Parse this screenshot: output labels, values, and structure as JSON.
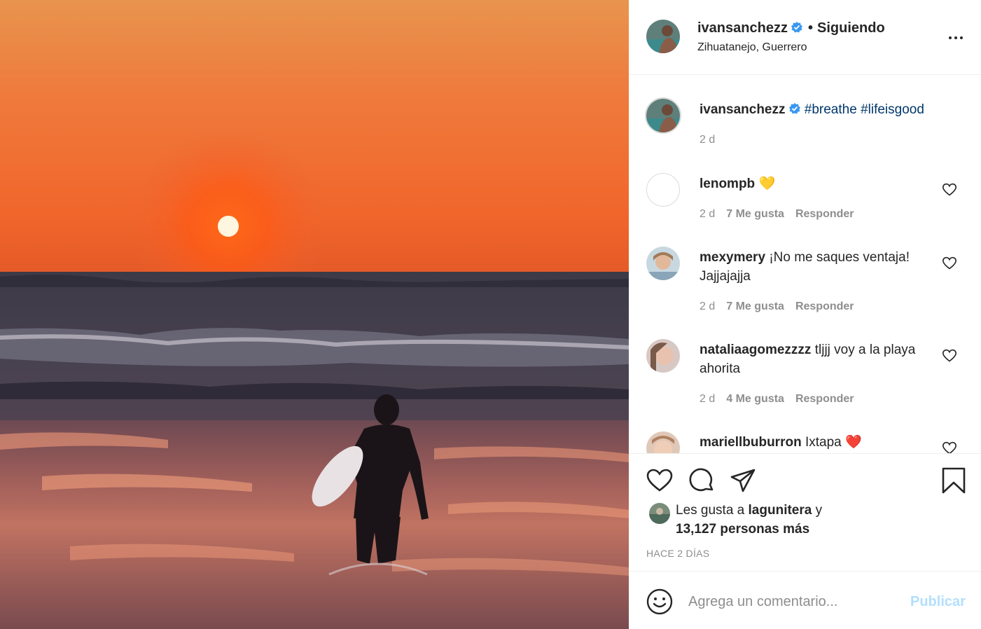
{
  "post": {
    "image_icon": "photo-sunset-surfer"
  },
  "header": {
    "username": "ivansanchezz",
    "separator": "•",
    "follow_status": "Siguiendo",
    "location": "Zihuatanejo, Guerrero",
    "more_icon": "more-horizontal-icon"
  },
  "caption": {
    "username": "ivansanchezz",
    "tag1": "#breathe",
    "emoji": "",
    "tag2": "#lifeisgood",
    "time": "2 d"
  },
  "comments": [
    {
      "username": "lenompb",
      "text": "💛",
      "time": "2 d",
      "likes": "7 Me gusta",
      "reply": "Responder"
    },
    {
      "username": "mexymery",
      "text": "¡No me saques ventaja! Jajjajajja",
      "time": "2 d",
      "likes": "7 Me gusta",
      "reply": "Responder"
    },
    {
      "username": "nataliaagomezzzz",
      "text": "tljjj voy a la playa ahorita",
      "time": "2 d",
      "likes": "4 Me gusta",
      "reply": "Responder"
    },
    {
      "username": "mariellbuburron",
      "text": "Ixtapa ❤️"
    }
  ],
  "actions": {
    "like_icon": "heart-icon",
    "comment_icon": "comment-icon",
    "share_icon": "paper-plane-icon",
    "save_icon": "bookmark-icon"
  },
  "likes": {
    "prefix": "Les gusta a ",
    "user": "lagunitera",
    "connector": " y",
    "count": "13,127 personas más"
  },
  "timestamp": "HACE 2 DÍAS",
  "add_comment": {
    "placeholder": "Agrega un comentario...",
    "publish": "Publicar"
  },
  "colors": {
    "verified": "#3897f0",
    "hashtag": "#00376b",
    "publish_disabled": "#b2dffc",
    "muted": "#8e8e8e"
  }
}
